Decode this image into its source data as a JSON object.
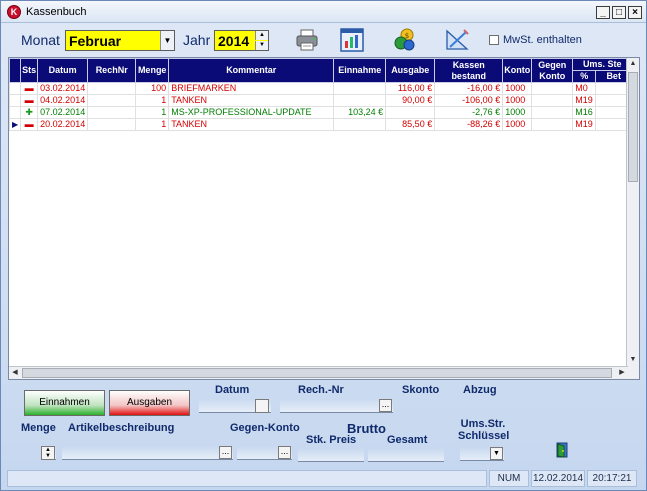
{
  "window": {
    "title": "Kassenbuch",
    "buttons": {
      "minimize": "_",
      "maximize": "□",
      "close": "×"
    }
  },
  "toolbar": {
    "month_label": "Monat",
    "month_value": "Februar",
    "year_label": "Jahr",
    "year_value": "2014",
    "icons": [
      "printer-icon",
      "chart-icon",
      "coins-icon",
      "ruler-icon"
    ],
    "mwst_label": "MwSt. enthalten",
    "mwst_checked": false
  },
  "grid": {
    "columns": [
      "Sts",
      "Datum",
      "RechNr",
      "Menge",
      "Kommentar",
      "Einnahme",
      "Ausgabe",
      "Kassen bestand",
      "Konto",
      "Gegen Konto",
      "Ums. Ste"
    ],
    "subcolumns": [
      "%",
      "Bet"
    ],
    "rows": [
      {
        "status": "minus",
        "datum": "03.02.2014",
        "rechnr": "",
        "menge": "100",
        "kommentar": "BRIEFMARKEN",
        "einnahme": "",
        "ausgabe": "116,00 €",
        "bestand": "-16,00 €",
        "konto": "1000",
        "gegen": "",
        "pct": "M0",
        "bet": "",
        "color": "#d40000"
      },
      {
        "status": "minus",
        "datum": "04.02.2014",
        "rechnr": "",
        "menge": "1",
        "kommentar": "TANKEN",
        "einnahme": "",
        "ausgabe": "90,00 €",
        "bestand": "-106,00 €",
        "konto": "1000",
        "gegen": "",
        "pct": "M19",
        "bet": "",
        "color": "#d40000"
      },
      {
        "status": "plus",
        "datum": "07.02.2014",
        "rechnr": "",
        "menge": "1",
        "kommentar": "MS-XP-PROFESSIONAL-UPDATE",
        "einnahme": "103,24 €",
        "ausgabe": "",
        "bestand": "-2,76 €",
        "konto": "1000",
        "gegen": "",
        "pct": "M16",
        "bet": "",
        "color": "#008000"
      },
      {
        "status": "minus",
        "datum": "20.02.2014",
        "rechnr": "",
        "menge": "1",
        "kommentar": "TANKEN",
        "einnahme": "",
        "ausgabe": "85,50 €",
        "bestand": "-88,26 €",
        "konto": "1000",
        "gegen": "",
        "pct": "M19",
        "bet": "",
        "color": "#d40000"
      }
    ]
  },
  "panel": {
    "btn_einnahmen": "Einnahmen",
    "btn_ausgaben": "Ausgaben",
    "datum_label": "Datum",
    "rechnr_label": "Rech.-Nr",
    "skonto_label": "Skonto",
    "abzug_label": "Abzug",
    "menge_label": "Menge",
    "artikel_label": "Artikelbeschreibung",
    "gegenkonto_label": "Gegen-Konto",
    "brutto_label": "Brutto",
    "stkpreis_label": "Stk. Preis",
    "gesamt_label": "Gesamt",
    "umsstr_label": "Ums.Str. Schlüssel"
  },
  "statusbar": {
    "num": "NUM",
    "date": "12.02.2014",
    "time": "20:17:21"
  },
  "colors": {
    "header_bg": "#0b0b78",
    "month_bg": "#ffff00",
    "expense": "#d40000",
    "income": "#008000"
  }
}
